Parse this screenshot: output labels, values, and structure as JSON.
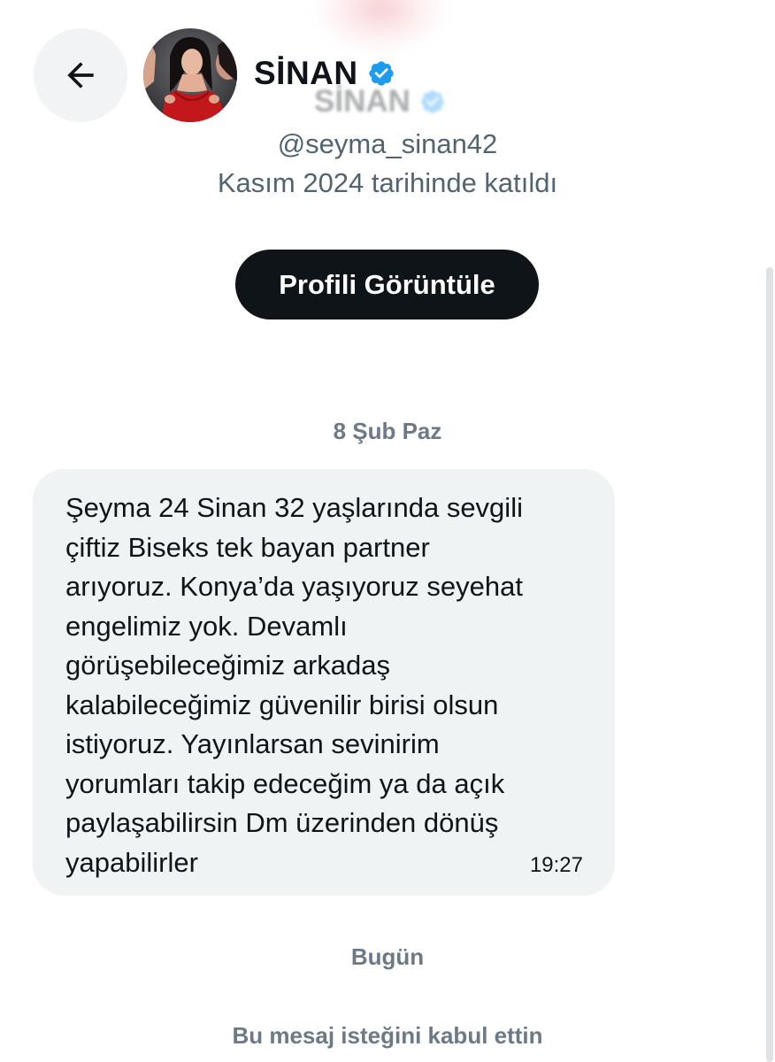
{
  "header": {
    "back_icon": "arrow-left-icon",
    "avatar_alt": "profile photo",
    "name": "SİNAN",
    "verified_icon": "verified-badge-icon",
    "ghost_name": "SİNAN"
  },
  "profile": {
    "handle": "@seyma_sinan42",
    "joined": "Kasım 2024 tarihinde katıldı",
    "view_profile_label": "Profili Görüntüle"
  },
  "conversation": {
    "date_separator_1": "8 Şub Paz",
    "message": {
      "text": "Şeyma 24 Sinan 32 yaşlarında sevgili\nçiftiz Biseks tek bayan partner\narıyoruz. Konya’da yaşıyoruz seyehat\nengelimiz yok. Devamlı\ngörüşebileceğimiz arkadaş\nkalabileceğimiz güvenilir birisi olsun\nistiyoruz. Yayınlarsan sevinirim\nyorumları takip edeceğim ya da açık\npaylaşabilirsin Dm üzerinden dönüş\nyapabilirler",
      "time": "19:27"
    },
    "date_separator_2": "Bugün",
    "system_notice": "Bu mesaj isteğini kabul ettin"
  },
  "colors": {
    "primary_text": "#0f1419",
    "secondary_text": "#536471",
    "verified_blue": "#1d9bf0",
    "bubble_bg": "#eff3f4",
    "button_bg": "#0f1419"
  }
}
